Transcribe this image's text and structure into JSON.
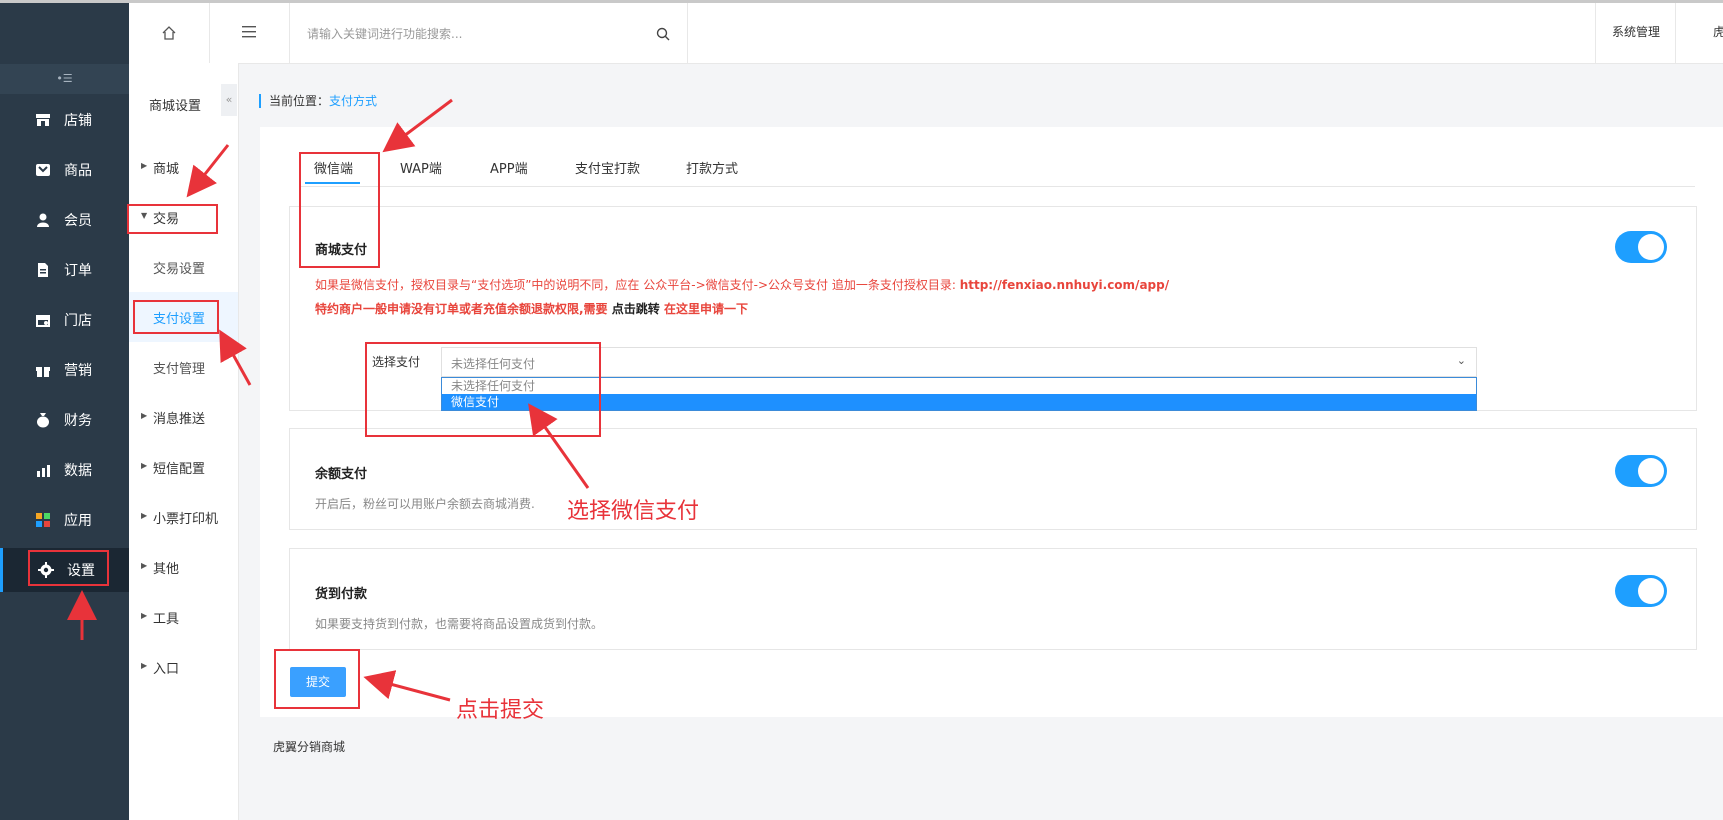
{
  "header": {
    "search_placeholder": "请输入关键词进行功能搜索...",
    "system_label": "系统管理",
    "user_label": "虎"
  },
  "sidebar": {
    "toggle_glyph": "•☰",
    "items": [
      {
        "label": "店铺",
        "icon": "store-icon"
      },
      {
        "label": "商品",
        "icon": "goods-icon"
      },
      {
        "label": "会员",
        "icon": "member-icon"
      },
      {
        "label": "订单",
        "icon": "order-icon"
      },
      {
        "label": "门店",
        "icon": "shop-icon"
      },
      {
        "label": "营销",
        "icon": "gift-icon"
      },
      {
        "label": "财务",
        "icon": "money-bag-icon"
      },
      {
        "label": "数据",
        "icon": "chart-icon"
      },
      {
        "label": "应用",
        "icon": "apps-icon"
      },
      {
        "label": "设置",
        "icon": "gear-icon",
        "active": true
      }
    ]
  },
  "subnav": {
    "title": "商城设置",
    "items": [
      {
        "label": "商城",
        "expandable": true
      },
      {
        "label": "交易",
        "expandable": true,
        "expanded": true
      },
      {
        "label": "交易设置",
        "child": true
      },
      {
        "label": "支付设置",
        "child": true,
        "selected": true
      },
      {
        "label": "支付管理",
        "child": true
      },
      {
        "label": "消息推送",
        "expandable": true
      },
      {
        "label": "短信配置",
        "expandable": true
      },
      {
        "label": "小票打印机",
        "expandable": true
      },
      {
        "label": "其他",
        "expandable": true
      },
      {
        "label": "工具",
        "expandable": true
      },
      {
        "label": "入口",
        "expandable": true
      }
    ]
  },
  "breadcrumb": {
    "prefix": "当前位置：",
    "current": "支付方式"
  },
  "tabs": [
    "微信端",
    "WAP端",
    "APP端",
    "支付宝打款",
    "打款方式"
  ],
  "mall_pay": {
    "title": "商城支付",
    "enabled": true,
    "notice1_prefix": "如果是微信支付，授权目录与“支付选项”中的说明不同，应在 公众平台->微信支付->公众号支付 追加一条支付授权目录: ",
    "notice1_url": "http://fenxiao.nnhuyi.com/app/",
    "notice2_prefix": "特约商户一般申请没有订单或者充值余额退款权限,需要 ",
    "notice2_link": "点击跳转",
    "notice2_suffix": " 在这里申请一下",
    "select_label": "选择支付",
    "select_value": "未选择任何支付",
    "options": [
      "未选择任何支付",
      "微信支付"
    ],
    "highlighted_option": "微信支付"
  },
  "balance_pay": {
    "title": "余额支付",
    "enabled": true,
    "desc": "开启后，粉丝可以用账户余额去商城消费."
  },
  "cod_pay": {
    "title": "货到付款",
    "enabled": true,
    "desc": "如果要支持货到付款，也需要将商品设置成货到付款。"
  },
  "submit_label": "提交",
  "footer": "虎翼分销商城",
  "annotations": {
    "choose_wechat": "选择微信支付",
    "click_submit": "点击提交"
  },
  "colors": {
    "accent": "#1e9fff",
    "sidebar": "#2b3a48",
    "annotation": "#e8333a"
  }
}
